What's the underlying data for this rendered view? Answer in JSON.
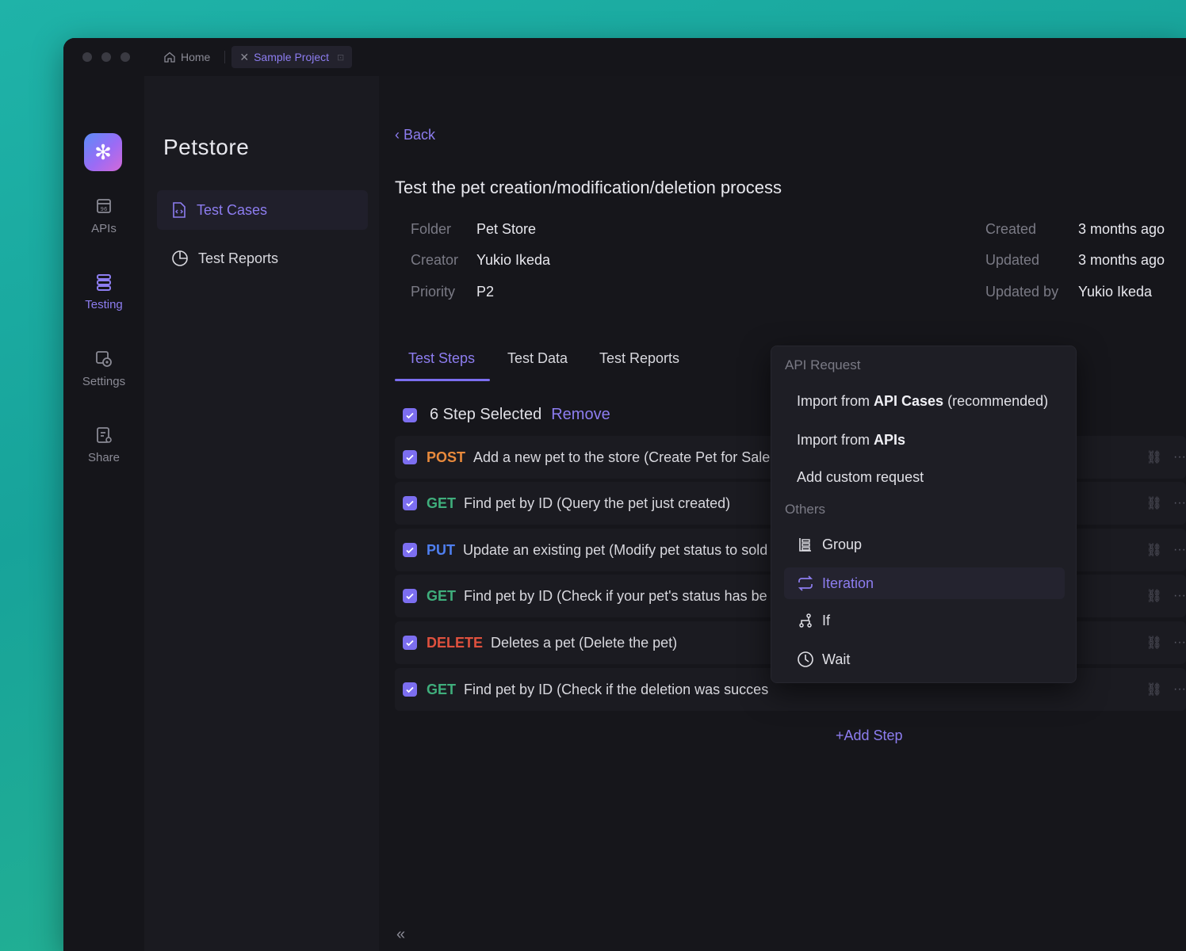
{
  "titlebar": {
    "home_label": "Home",
    "project_tab_label": "Sample Project"
  },
  "rail": {
    "items": [
      {
        "label": "APIs",
        "icon": "api-icon"
      },
      {
        "label": "Testing",
        "icon": "testing-icon",
        "active": true
      },
      {
        "label": "Settings",
        "icon": "settings-icon"
      },
      {
        "label": "Share",
        "icon": "share-icon"
      }
    ]
  },
  "panel": {
    "project_name": "Petstore",
    "nav": [
      {
        "label": "Test Cases",
        "icon": "test-case-file-icon",
        "active": true
      },
      {
        "label": "Test Reports",
        "icon": "pie-chart-icon"
      }
    ]
  },
  "main": {
    "back_label": "Back",
    "title": "Test the pet creation/modification/deletion process",
    "meta_left": [
      {
        "label": "Folder",
        "value": "Pet Store"
      },
      {
        "label": "Creator",
        "value": "Yukio Ikeda"
      },
      {
        "label": "Priority",
        "value": "P2"
      }
    ],
    "meta_right": [
      {
        "label": "Created",
        "value": "3 months ago"
      },
      {
        "label": "Updated",
        "value": "3 months ago"
      },
      {
        "label": "Updated by",
        "value": "Yukio Ikeda"
      }
    ],
    "tabs": [
      "Test Steps",
      "Test Data",
      "Test Reports"
    ],
    "selection_text": "6 Step Selected",
    "remove_label": "Remove",
    "steps": [
      {
        "method": "POST",
        "desc": "Add a new pet to the store (Create Pet for Sale"
      },
      {
        "method": "GET",
        "desc": "Find pet by ID (Query the pet just created)"
      },
      {
        "method": "PUT",
        "desc": "Update an existing pet (Modify pet status to sold"
      },
      {
        "method": "GET",
        "desc": "Find pet by ID (Check if your pet's status has be"
      },
      {
        "method": "DELETE",
        "desc": "Deletes a pet (Delete the pet)"
      },
      {
        "method": "GET",
        "desc": "Find pet by ID (Check if the deletion was succes"
      }
    ],
    "add_step_label": "Add Step"
  },
  "dropdown": {
    "section_api": "API Request",
    "import_api_cases_prefix": "Import from ",
    "import_api_cases_bold": "API Cases",
    "import_api_cases_suffix": " (recommended)",
    "import_apis_prefix": "Import from ",
    "import_apis_bold": "APIs",
    "add_custom": "Add custom request",
    "section_others": "Others",
    "group": "Group",
    "iteration": "Iteration",
    "if": "If",
    "wait": "Wait"
  },
  "colors": {
    "accent": "#7c6ef0",
    "post": "#e98a3c",
    "get": "#3fae7c",
    "put": "#4f7ff0",
    "delete": "#e0513e"
  }
}
